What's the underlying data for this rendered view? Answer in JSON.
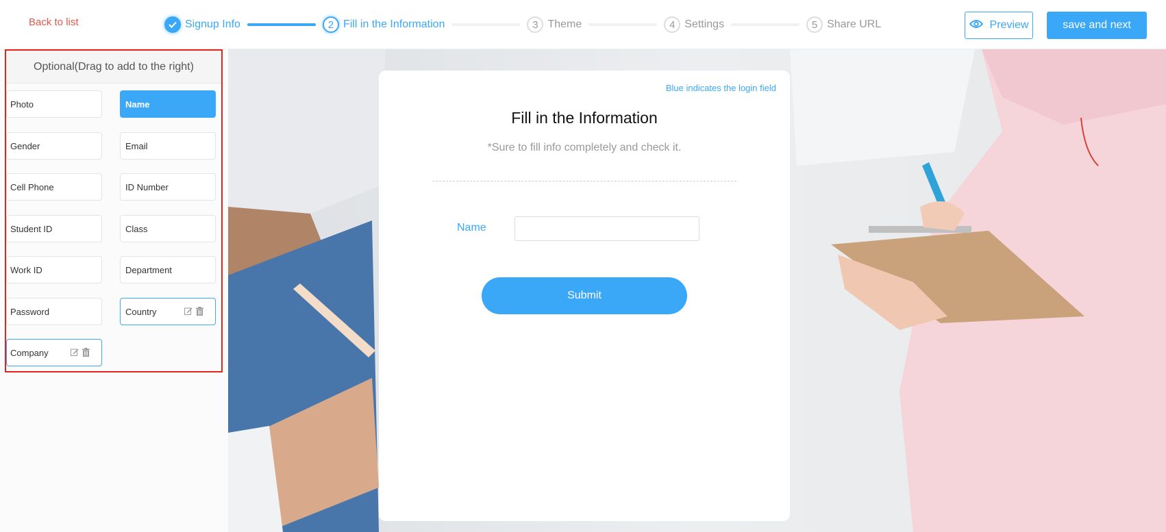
{
  "header": {
    "back_label": "Back to list",
    "steps": [
      {
        "number": "1",
        "label": "Signup Info",
        "state": "done"
      },
      {
        "number": "2",
        "label": "Fill in the Information",
        "state": "active"
      },
      {
        "number": "3",
        "label": "Theme",
        "state": "pending"
      },
      {
        "number": "4",
        "label": "Settings",
        "state": "pending"
      },
      {
        "number": "5",
        "label": "Share URL",
        "state": "pending"
      }
    ],
    "preview_label": "Preview",
    "save_label": "save and next"
  },
  "left_panel": {
    "title": "Optional(Drag to add to the right)",
    "fields": [
      {
        "label": "Photo",
        "state": "default"
      },
      {
        "label": "Name",
        "state": "selected"
      },
      {
        "label": "Gender",
        "state": "default"
      },
      {
        "label": "Email",
        "state": "default"
      },
      {
        "label": "Cell Phone",
        "state": "default"
      },
      {
        "label": "ID Number",
        "state": "default"
      },
      {
        "label": "Student ID",
        "state": "default"
      },
      {
        "label": "Class",
        "state": "default"
      },
      {
        "label": "Work ID",
        "state": "default"
      },
      {
        "label": "Department",
        "state": "default"
      },
      {
        "label": "Password",
        "state": "default"
      },
      {
        "label": "Country",
        "state": "custom"
      },
      {
        "label": "Company",
        "state": "custom"
      }
    ]
  },
  "form_card": {
    "login_hint": "Blue indicates the login field",
    "title": "Fill in the Information",
    "subtitle": "*Sure to fill info completely and check it.",
    "fields": [
      {
        "label": "Name",
        "value": "",
        "placeholder": ""
      }
    ],
    "submit_label": "Submit"
  },
  "colors": {
    "accent": "#3aa8f7",
    "back_link": "#e8574a",
    "highlight_outline": "#e8221c"
  }
}
